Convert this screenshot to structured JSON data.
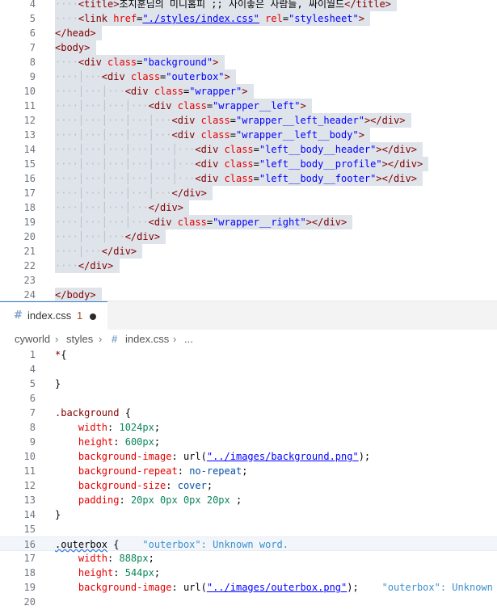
{
  "top_editor": {
    "lines": [
      {
        "n": "4",
        "parts": [
          [
            "guide",
            "····"
          ],
          [
            "tag",
            "<title>"
          ],
          [
            "txt",
            "조지훈님의 미니홈피 ;; 사이좋은 사람들, 싸이월드"
          ],
          [
            "tag",
            "</title>"
          ]
        ]
      },
      {
        "n": "5",
        "parts": [
          [
            "guide",
            "····"
          ],
          [
            "tag",
            "<link "
          ],
          [
            "attr",
            "href"
          ],
          [
            "txt",
            "="
          ],
          [
            "link",
            "\"./styles/index.css\""
          ],
          [
            "txt",
            " "
          ],
          [
            "attr",
            "rel"
          ],
          [
            "txt",
            "="
          ],
          [
            "str",
            "\"stylesheet\""
          ],
          [
            "tag",
            ">"
          ]
        ]
      },
      {
        "n": "6",
        "parts": [
          [
            "tag",
            "</head>"
          ]
        ]
      },
      {
        "n": "7",
        "parts": [
          [
            "tag",
            "<body>"
          ]
        ]
      },
      {
        "n": "8",
        "parts": [
          [
            "guide",
            "····"
          ],
          [
            "tag",
            "<div "
          ],
          [
            "attr",
            "class"
          ],
          [
            "txt",
            "="
          ],
          [
            "str",
            "\"background\""
          ],
          [
            "tag",
            ">"
          ]
        ]
      },
      {
        "n": "9",
        "parts": [
          [
            "guide",
            "····│···"
          ],
          [
            "tag",
            "<div "
          ],
          [
            "attr",
            "class"
          ],
          [
            "txt",
            "="
          ],
          [
            "str",
            "\"outerbox\""
          ],
          [
            "tag",
            ">"
          ]
        ]
      },
      {
        "n": "10",
        "parts": [
          [
            "guide",
            "····│···│···"
          ],
          [
            "tag",
            "<div "
          ],
          [
            "attr",
            "class"
          ],
          [
            "txt",
            "="
          ],
          [
            "str",
            "\"wrapper\""
          ],
          [
            "tag",
            ">"
          ]
        ]
      },
      {
        "n": "11",
        "parts": [
          [
            "guide",
            "····│···│···│···"
          ],
          [
            "tag",
            "<div "
          ],
          [
            "attr",
            "class"
          ],
          [
            "txt",
            "="
          ],
          [
            "str",
            "\"wrapper__left\""
          ],
          [
            "tag",
            ">"
          ]
        ]
      },
      {
        "n": "12",
        "parts": [
          [
            "guide",
            "····│···│···│···│···"
          ],
          [
            "tag",
            "<div "
          ],
          [
            "attr",
            "class"
          ],
          [
            "txt",
            "="
          ],
          [
            "str",
            "\"wrapper__left_header\""
          ],
          [
            "tag",
            "></div>"
          ]
        ]
      },
      {
        "n": "13",
        "parts": [
          [
            "guide",
            "····│···│···│···│···"
          ],
          [
            "tag",
            "<div "
          ],
          [
            "attr",
            "class"
          ],
          [
            "txt",
            "="
          ],
          [
            "str",
            "\"wrapper__left__body\""
          ],
          [
            "tag",
            ">"
          ]
        ]
      },
      {
        "n": "14",
        "parts": [
          [
            "guide",
            "····│···│···│···│···│···"
          ],
          [
            "tag",
            "<div "
          ],
          [
            "attr",
            "class"
          ],
          [
            "txt",
            "="
          ],
          [
            "str",
            "\"left__body__header\""
          ],
          [
            "tag",
            "></div>"
          ]
        ]
      },
      {
        "n": "15",
        "parts": [
          [
            "guide",
            "····│···│···│···│···│···"
          ],
          [
            "tag",
            "<div "
          ],
          [
            "attr",
            "class"
          ],
          [
            "txt",
            "="
          ],
          [
            "str",
            "\"left__body__profile\""
          ],
          [
            "tag",
            "></div>"
          ]
        ]
      },
      {
        "n": "16",
        "parts": [
          [
            "guide",
            "····│···│···│···│···│···"
          ],
          [
            "tag",
            "<div "
          ],
          [
            "attr",
            "class"
          ],
          [
            "txt",
            "="
          ],
          [
            "str",
            "\"left__body__footer\""
          ],
          [
            "tag",
            "></div>"
          ]
        ]
      },
      {
        "n": "17",
        "parts": [
          [
            "guide",
            "····│···│···│···│···"
          ],
          [
            "tag",
            "</div>"
          ]
        ]
      },
      {
        "n": "18",
        "parts": [
          [
            "guide",
            "····│···│···│···"
          ],
          [
            "tag",
            "</div>"
          ]
        ]
      },
      {
        "n": "19",
        "parts": [
          [
            "guide",
            "····│···│···│···"
          ],
          [
            "tag",
            "<div "
          ],
          [
            "attr",
            "class"
          ],
          [
            "txt",
            "="
          ],
          [
            "str",
            "\"wrapper__right\""
          ],
          [
            "tag",
            "></div>"
          ]
        ]
      },
      {
        "n": "20",
        "parts": [
          [
            "guide",
            "····│···│···"
          ],
          [
            "tag",
            "</div>"
          ]
        ]
      },
      {
        "n": "21",
        "parts": [
          [
            "guide",
            "····│···"
          ],
          [
            "tag",
            "</div>"
          ]
        ]
      },
      {
        "n": "22",
        "parts": [
          [
            "guide",
            "····"
          ],
          [
            "tag",
            "</div>"
          ]
        ]
      },
      {
        "n": "23",
        "parts": []
      },
      {
        "n": "24",
        "parts": [
          [
            "tag",
            "</body>"
          ]
        ]
      }
    ]
  },
  "tab": {
    "icon": "#",
    "name": "index.css",
    "problems": "1"
  },
  "breadcrumb": {
    "folder1": "cyworld",
    "folder2": "styles",
    "file_icon": "#",
    "file": "index.css",
    "more": "..."
  },
  "bottom_editor": {
    "lines": [
      {
        "n": "1",
        "parts": [
          [
            "sel-name",
            "*"
          ],
          [
            "punc",
            "{"
          ]
        ]
      },
      {
        "n": "4",
        "parts": []
      },
      {
        "n": "5",
        "parts": [
          [
            "punc",
            "}"
          ]
        ]
      },
      {
        "n": "6",
        "parts": []
      },
      {
        "n": "7",
        "parts": [
          [
            "sel-name",
            ".background"
          ],
          [
            "punc",
            " {"
          ]
        ]
      },
      {
        "n": "8",
        "parts": [
          [
            "txt",
            "    "
          ],
          [
            "prop",
            "width"
          ],
          [
            "punc",
            ": "
          ],
          [
            "val",
            "1024px"
          ],
          [
            "punc",
            ";"
          ]
        ]
      },
      {
        "n": "9",
        "parts": [
          [
            "txt",
            "    "
          ],
          [
            "prop",
            "height"
          ],
          [
            "punc",
            ": "
          ],
          [
            "val",
            "600px"
          ],
          [
            "punc",
            ";"
          ]
        ]
      },
      {
        "n": "10",
        "parts": [
          [
            "txt",
            "    "
          ],
          [
            "prop",
            "background-image"
          ],
          [
            "punc",
            ": url("
          ],
          [
            "link",
            "\"../images/background.png\""
          ],
          [
            "punc",
            ");"
          ]
        ]
      },
      {
        "n": "11",
        "parts": [
          [
            "txt",
            "    "
          ],
          [
            "prop",
            "background-repeat"
          ],
          [
            "punc",
            ": "
          ],
          [
            "kw",
            "no-repeat"
          ],
          [
            "punc",
            ";"
          ]
        ]
      },
      {
        "n": "12",
        "parts": [
          [
            "txt",
            "    "
          ],
          [
            "prop",
            "background-size"
          ],
          [
            "punc",
            ": "
          ],
          [
            "kw",
            "cover"
          ],
          [
            "punc",
            ";"
          ]
        ]
      },
      {
        "n": "13",
        "parts": [
          [
            "txt",
            "    "
          ],
          [
            "prop",
            "padding"
          ],
          [
            "punc",
            ": "
          ],
          [
            "val",
            "20px 0px 0px 20px"
          ],
          [
            "punc",
            " ;"
          ]
        ]
      },
      {
        "n": "14",
        "parts": [
          [
            "punc",
            "}"
          ]
        ]
      },
      {
        "n": "15",
        "parts": []
      },
      {
        "n": "16",
        "parts": [
          [
            "squiggle",
            ".outerbox"
          ],
          [
            "punc",
            " {"
          ],
          [
            "diag",
            "    \"outerbox\": Unknown word."
          ]
        ]
      },
      {
        "n": "17",
        "parts": [
          [
            "txt",
            "    "
          ],
          [
            "prop",
            "width"
          ],
          [
            "punc",
            ": "
          ],
          [
            "val",
            "888px"
          ],
          [
            "punc",
            ";"
          ]
        ]
      },
      {
        "n": "18",
        "parts": [
          [
            "txt",
            "    "
          ],
          [
            "prop",
            "height"
          ],
          [
            "punc",
            ": "
          ],
          [
            "val",
            "544px"
          ],
          [
            "punc",
            ";"
          ]
        ]
      },
      {
        "n": "19",
        "parts": [
          [
            "txt",
            "    "
          ],
          [
            "prop",
            "background-image"
          ],
          [
            "punc",
            ": url("
          ],
          [
            "link",
            "\"../images/outerbox.png\""
          ],
          [
            "punc",
            ");"
          ],
          [
            "diag",
            "    \"outerbox\": Unknown"
          ]
        ]
      },
      {
        "n": "20",
        "parts": []
      }
    ]
  }
}
